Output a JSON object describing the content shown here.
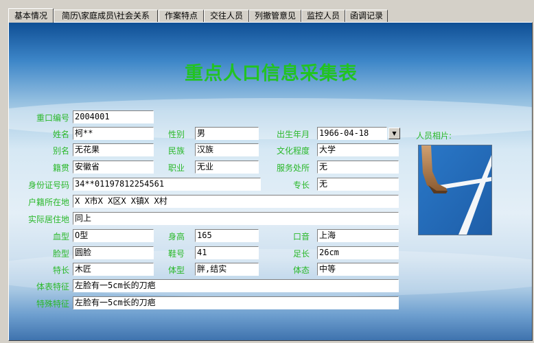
{
  "tabs": [
    "基本情况",
    "简历\\家庭成员\\社会关系",
    "作案特点",
    "交往人员",
    "列撤管意见",
    "监控人员",
    "函调记录"
  ],
  "title": "重点人口信息采集表",
  "photo_label": "人员相片:",
  "labels": {
    "id_no": "重口编号",
    "name": "姓名",
    "gender": "性别",
    "birth": "出生年月",
    "alias": "别名",
    "ethnicity": "民族",
    "education": "文化程度",
    "native": "籍贯",
    "occupation": "职业",
    "workplace": "服务处所",
    "id_card": "身份证号码",
    "specialty": "专长",
    "household": "户籍所在地",
    "residence": "实际居住地",
    "blood": "血型",
    "height": "身高",
    "accent": "口音",
    "face": "脸型",
    "shoe": "鞋号",
    "foot": "足长",
    "skill": "特长",
    "build": "体型",
    "posture": "体态",
    "marks": "体表特征",
    "special": "特殊特征"
  },
  "values": {
    "id_no": "2004001",
    "name": "柯**",
    "gender": "男",
    "birth": "1966-04-18",
    "alias": "无花果",
    "ethnicity": "汉族",
    "education": "大学",
    "native": "安徽省",
    "occupation": "无业",
    "workplace": "无",
    "id_card": "34**01197812254561",
    "specialty": "无",
    "household": "X X市X X区X X镇X X村",
    "residence": "同上",
    "blood": "O型",
    "height": "165",
    "accent": "上海",
    "face": "圆脸",
    "shoe": "41",
    "foot": "26cm",
    "skill": "木匠",
    "build": "胖,结实",
    "posture": "中等",
    "marks": "左脸有一5cm长的刀疤",
    "special": "左脸有一5cm长的刀疤"
  },
  "icons": {
    "dropdown": "triangle-down-icon"
  },
  "colors": {
    "label": "#2ab82a",
    "title": "#22c322"
  }
}
